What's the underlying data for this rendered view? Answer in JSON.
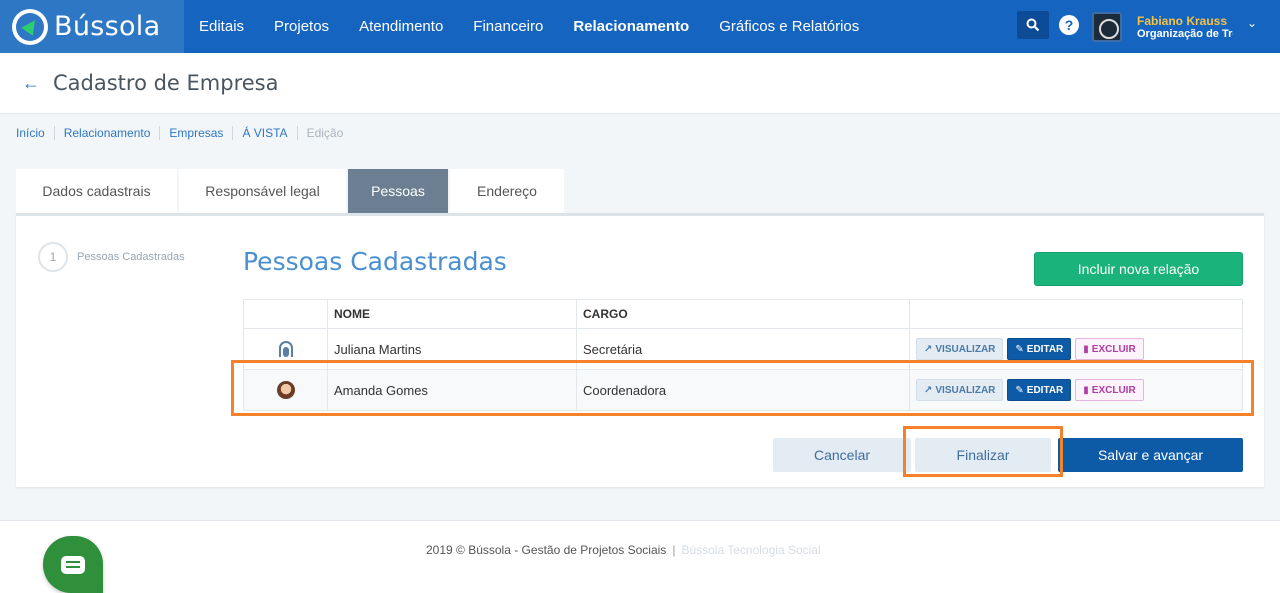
{
  "app": {
    "logo_text": "Bússola"
  },
  "nav": {
    "items": [
      {
        "label": "Editais",
        "active": false
      },
      {
        "label": "Projetos",
        "active": false
      },
      {
        "label": "Atendimento",
        "active": false
      },
      {
        "label": "Financeiro",
        "active": false
      },
      {
        "label": "Relacionamento",
        "active": true
      },
      {
        "label": "Gráficos e Relatórios",
        "active": false
      }
    ]
  },
  "header": {
    "search_icon": "search-icon",
    "help_label": "?",
    "user_name": "Fabiano Krauss",
    "user_org": "Organização de Tre",
    "caret": "⌄"
  },
  "page": {
    "back_icon": "←",
    "title": "Cadastro de Empresa"
  },
  "breadcrumb": [
    "Início",
    "Relacionamento",
    "Empresas",
    "Á VISTA",
    "Edição"
  ],
  "tabs": [
    {
      "label": "Dados cadastrais",
      "active": false
    },
    {
      "label": "Responsável legal",
      "active": false
    },
    {
      "label": "Pessoas",
      "active": true
    },
    {
      "label": "Endereço",
      "active": false
    }
  ],
  "stepper": {
    "number": "1",
    "label": "Pessoas Cadastradas"
  },
  "section": {
    "title": "Pessoas Cadastradas",
    "add_button": "Incluir nova relação"
  },
  "table": {
    "headers": [
      "",
      "NOME",
      "CARGO",
      ""
    ],
    "rows": [
      {
        "avatar": "headset-avatar",
        "nome": "Juliana Martins",
        "cargo": "Secretária"
      },
      {
        "avatar": "photo-avatar",
        "nome": "Amanda Gomes",
        "cargo": "Coordenadora"
      }
    ],
    "actions": {
      "view": "VISUALIZAR",
      "edit": "EDITAR",
      "delete": "EXCLUIR"
    }
  },
  "footer_buttons": {
    "cancel": "Cancelar",
    "finish": "Finalizar",
    "save_next": "Salvar e avançar"
  },
  "footer": {
    "copyright": "2019 © Bússola - Gestão de Projetos Sociais",
    "separator": "|",
    "link": "Bússola Tecnologia Social"
  },
  "colors": {
    "nav_bg": "#1565c0",
    "accent": "#0d5aa7",
    "success": "#19b37b",
    "highlight": "#f5822a"
  }
}
